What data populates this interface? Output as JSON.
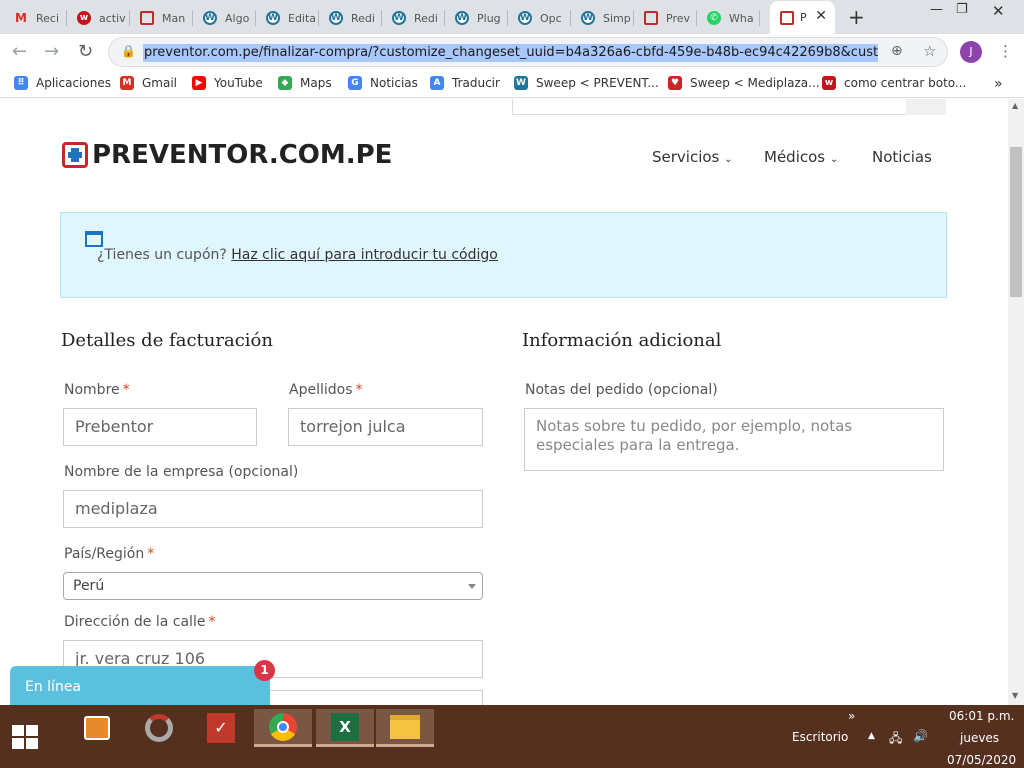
{
  "browser": {
    "tabs": [
      {
        "label": "Reci",
        "icon": "gmail-icon"
      },
      {
        "label": "activ",
        "icon": "wordpress-red-icon"
      },
      {
        "label": "Man",
        "icon": "preventor-icon"
      },
      {
        "label": "Algo",
        "icon": "wordpress-icon"
      },
      {
        "label": "Edita",
        "icon": "wordpress-icon"
      },
      {
        "label": "Redi",
        "icon": "wordpress-icon"
      },
      {
        "label": "Redi",
        "icon": "wordpress-icon"
      },
      {
        "label": "Plug",
        "icon": "wordpress-icon"
      },
      {
        "label": "Opc",
        "icon": "wordpress-icon"
      },
      {
        "label": "Simp",
        "icon": "wordpress-icon"
      },
      {
        "label": "Prev",
        "icon": "preventor-icon"
      },
      {
        "label": "Wha",
        "icon": "whatsapp-icon"
      }
    ],
    "active_tab": {
      "label": "P"
    },
    "url": "preventor.com.pe/finalizar-compra/?customize_changeset_uuid=b4a326a6-cbfd-459e-b48b-ec94c42269b8&customize",
    "profile_initial": "J",
    "bookmarks": [
      {
        "label": "Aplicaciones",
        "icon": "apps-grid-icon"
      },
      {
        "label": "Gmail",
        "icon": "gmail-icon"
      },
      {
        "label": "YouTube",
        "icon": "youtube-icon"
      },
      {
        "label": "Maps",
        "icon": "maps-icon"
      },
      {
        "label": "Noticias",
        "icon": "news-icon"
      },
      {
        "label": "Traducir",
        "icon": "translate-icon"
      },
      {
        "label": "Sweep < PREVENT...",
        "icon": "wordpress-icon"
      },
      {
        "label": "Sweep < Mediplaza...",
        "icon": "heart-icon"
      },
      {
        "label": "como centrar boto...",
        "icon": "wordpress-red-icon"
      }
    ],
    "more": "»"
  },
  "site": {
    "logo": "PREVENTOR.COM.PE",
    "nav": [
      "Servicios",
      "Médicos",
      "Noticias"
    ]
  },
  "coupon": {
    "question": "¿Tienes un cupón?",
    "link": "Haz clic aquí para introducir tu código"
  },
  "billing": {
    "title": "Detalles de facturación",
    "first_name": {
      "label": "Nombre",
      "value": "Prebentor"
    },
    "last_name": {
      "label": "Apellidos",
      "value": "torrejon julca"
    },
    "company": {
      "label": "Nombre de la empresa (opcional)",
      "value": "mediplaza"
    },
    "country": {
      "label": "País/Región",
      "value": "Perú"
    },
    "street": {
      "label": "Dirección de la calle",
      "value": "jr. vera cruz 106"
    }
  },
  "additional": {
    "title": "Información adicional",
    "notes_label": "Notas del pedido (opcional)",
    "notes_placeholder": "Notas sobre tu pedido, por ejemplo, notas especiales para la entrega."
  },
  "chat": {
    "label": "En línea",
    "badge": "1"
  },
  "taskbar": {
    "desktop_label": "Escritorio",
    "chevron": "»",
    "time": "06:01 p.m.",
    "day": "jueves",
    "date": "07/05/2020"
  },
  "colors": {
    "required": "#e2401c",
    "coupon_bg": "#e0f6fd",
    "chat": "#5bc0de",
    "taskbar": "#55301f"
  }
}
